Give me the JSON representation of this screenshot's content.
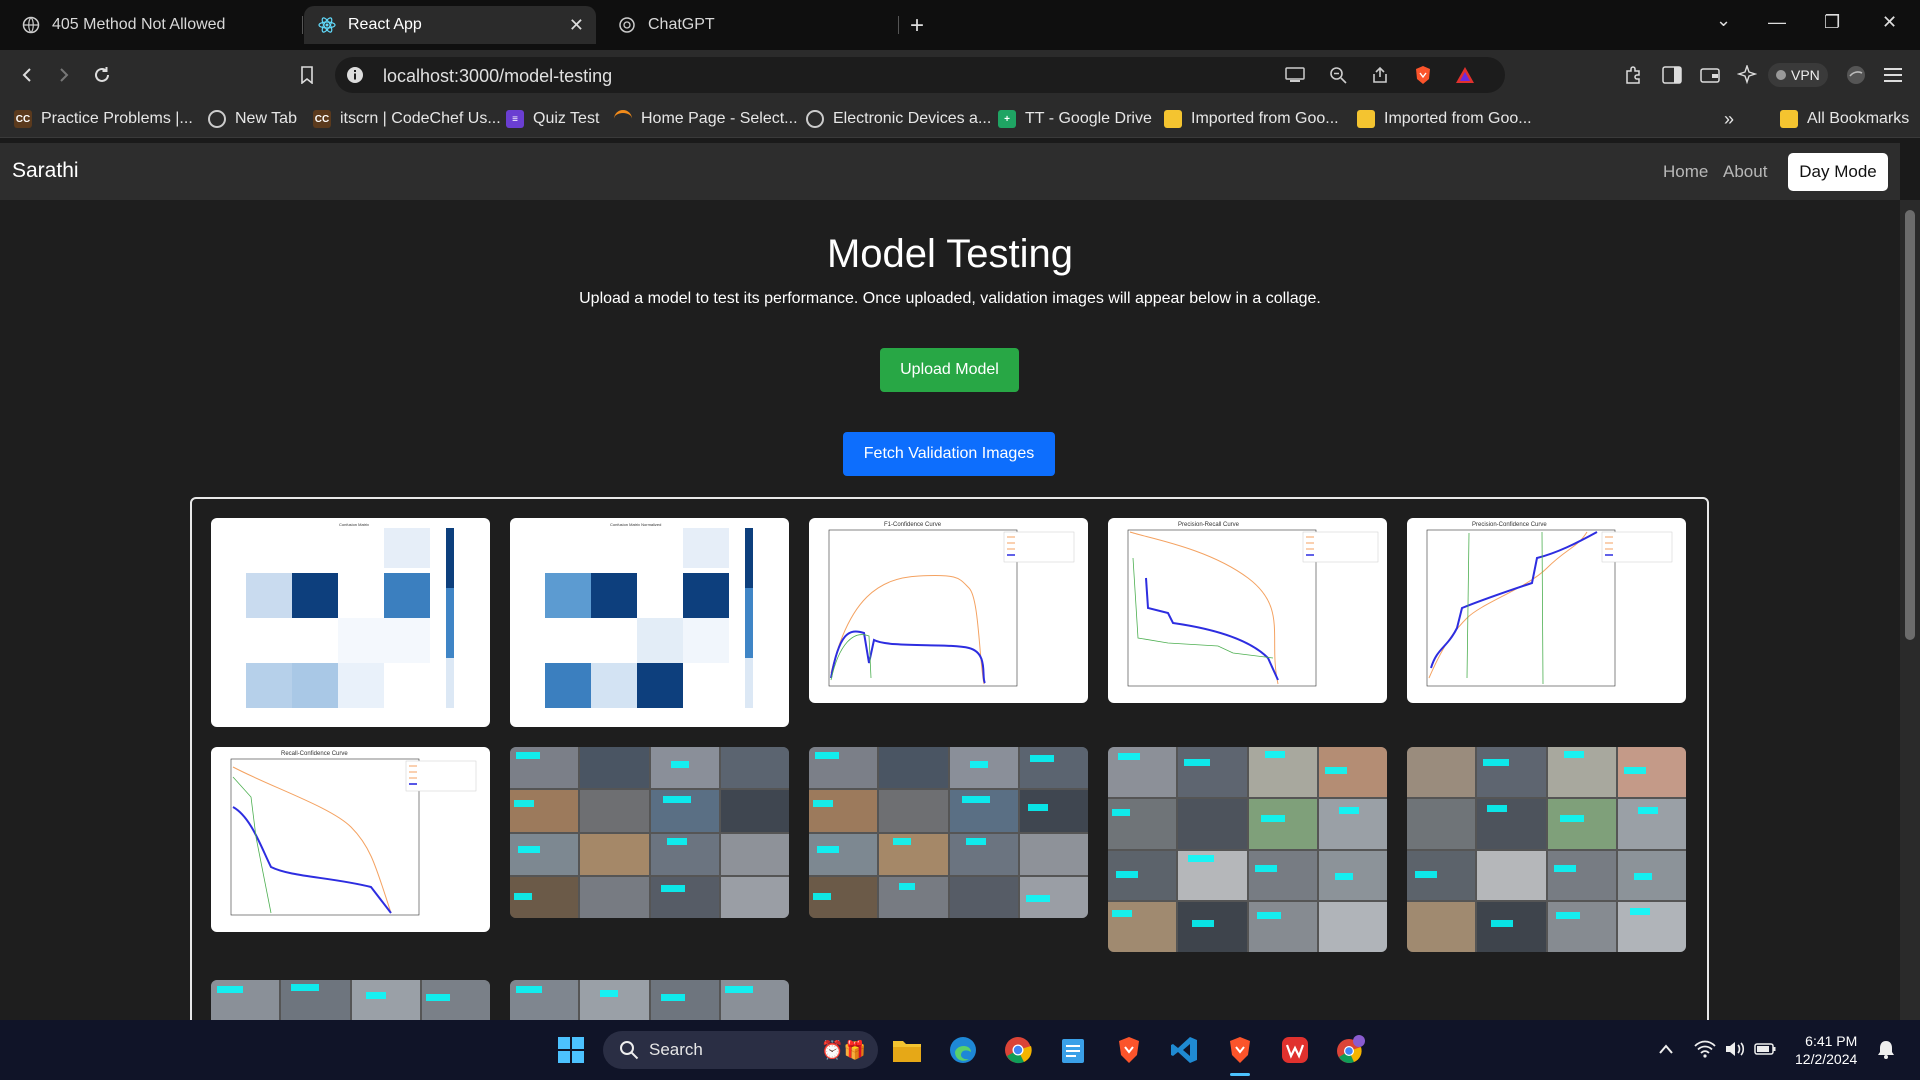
{
  "browser": {
    "tabs": [
      {
        "title": "405 Method Not Allowed",
        "active": false
      },
      {
        "title": "React App",
        "active": true
      },
      {
        "title": "ChatGPT",
        "active": false
      }
    ],
    "url": "localhost:3000/model-testing",
    "vpn_label": "VPN",
    "bookmarks": [
      {
        "label": "Practice Problems |...",
        "icon": "codechef-icon"
      },
      {
        "label": "New Tab",
        "icon": "globe-icon"
      },
      {
        "label": "itscrn | CodeChef Us...",
        "icon": "codechef-icon"
      },
      {
        "label": "Quiz Test",
        "icon": "form-icon"
      },
      {
        "label": "Home Page - Select...",
        "icon": "arc-icon"
      },
      {
        "label": "Electronic Devices a...",
        "icon": "globe-icon"
      },
      {
        "label": "TT - Google Drive",
        "icon": "sheets-icon"
      },
      {
        "label": "Imported from Goo...",
        "icon": "folder-icon"
      },
      {
        "label": "Imported from Goo...",
        "icon": "folder-icon"
      }
    ],
    "all_bookmarks_label": "All Bookmarks"
  },
  "app": {
    "brand": "Sarathi",
    "nav": {
      "home": "Home",
      "about": "About",
      "day_mode": "Day Mode"
    },
    "title": "Model Testing",
    "subtitle": "Upload a model to test its performance. Once uploaded, validation images will appear below in a collage.",
    "upload_button": "Upload Model",
    "fetch_button": "Fetch Validation Images"
  },
  "collage_images": [
    {
      "kind": "confusion-matrix",
      "title": "Confusion Matrix"
    },
    {
      "kind": "confusion-matrix",
      "title": "Confusion Matrix Normalized"
    },
    {
      "kind": "curve",
      "title": "F1-Confidence Curve"
    },
    {
      "kind": "curve",
      "title": "Precision-Recall Curve"
    },
    {
      "kind": "curve",
      "title": "Precision-Confidence Curve"
    },
    {
      "kind": "curve",
      "title": "Recall-Confidence Curve"
    },
    {
      "kind": "photo-grid"
    },
    {
      "kind": "photo-grid"
    },
    {
      "kind": "photo-grid"
    },
    {
      "kind": "photo-grid"
    },
    {
      "kind": "photo-grid"
    },
    {
      "kind": "photo-grid"
    }
  ],
  "taskbar": {
    "search_label": "Search",
    "time": "6:41 PM",
    "date": "12/2/2024"
  },
  "colors": {
    "green_button": "#28a745",
    "blue_button": "#0d6efd",
    "navbar": "#2d2d2d",
    "page_bg": "#1e1e1e"
  }
}
